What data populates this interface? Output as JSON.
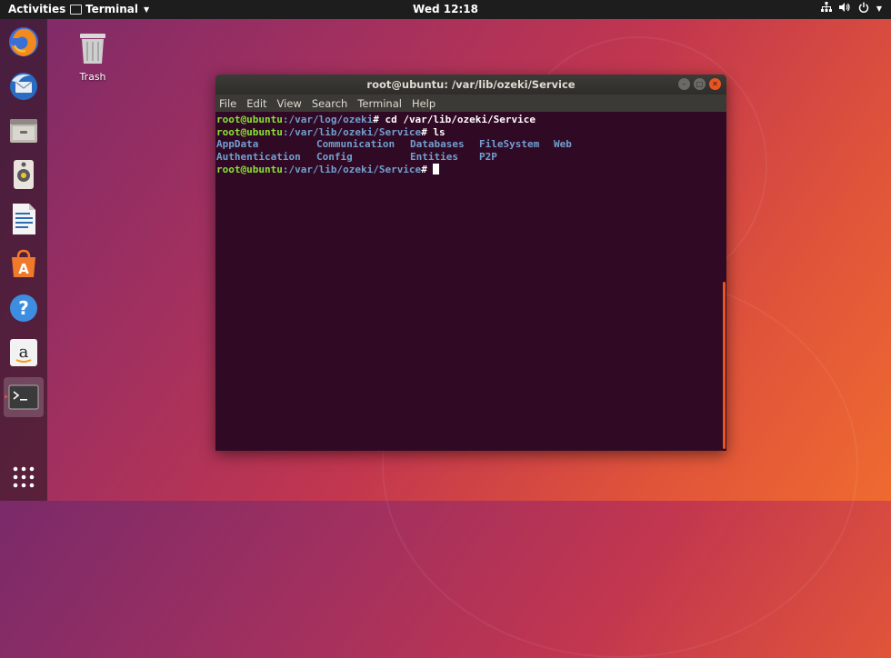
{
  "topbar": {
    "activities": "Activities",
    "app_name": "Terminal",
    "clock": "Wed 12:18",
    "tray_icons": [
      "network-icon",
      "volume-icon",
      "power-icon"
    ]
  },
  "dock": {
    "items": [
      "firefox-icon",
      "thunderbird-icon",
      "files-icon",
      "rhythmbox-icon",
      "libreoffice-writer-icon",
      "software-center-icon",
      "help-icon",
      "amazon-icon",
      "terminal-icon"
    ],
    "show_apps": "show-applications-icon"
  },
  "desktop": {
    "trash_label": "Trash"
  },
  "window": {
    "title": "root@ubuntu: /var/lib/ozeki/Service",
    "menu": [
      "File",
      "Edit",
      "View",
      "Search",
      "Terminal",
      "Help"
    ]
  },
  "terminal": {
    "lines": [
      {
        "user": "root@ubuntu",
        "path": ":/var/log/ozeki",
        "cmd": "# cd /var/lib/ozeki/Service"
      },
      {
        "user": "root@ubuntu",
        "path": ":/var/lib/ozeki/Service",
        "cmd": "# ls"
      },
      {
        "listing": [
          "AppData",
          "Communication",
          "Databases",
          "FileSystem",
          "Web"
        ]
      },
      {
        "listing": [
          "Authentication",
          "Config",
          "Entities",
          "P2P"
        ]
      },
      {
        "user": "root@ubuntu",
        "path": ":/var/lib/ozeki/Service",
        "cmd": "# "
      }
    ]
  },
  "colors": {
    "accent": "#e95420",
    "terminal_bg": "#300a24",
    "prompt_user": "#8ae234",
    "prompt_path": "#729fcf"
  }
}
